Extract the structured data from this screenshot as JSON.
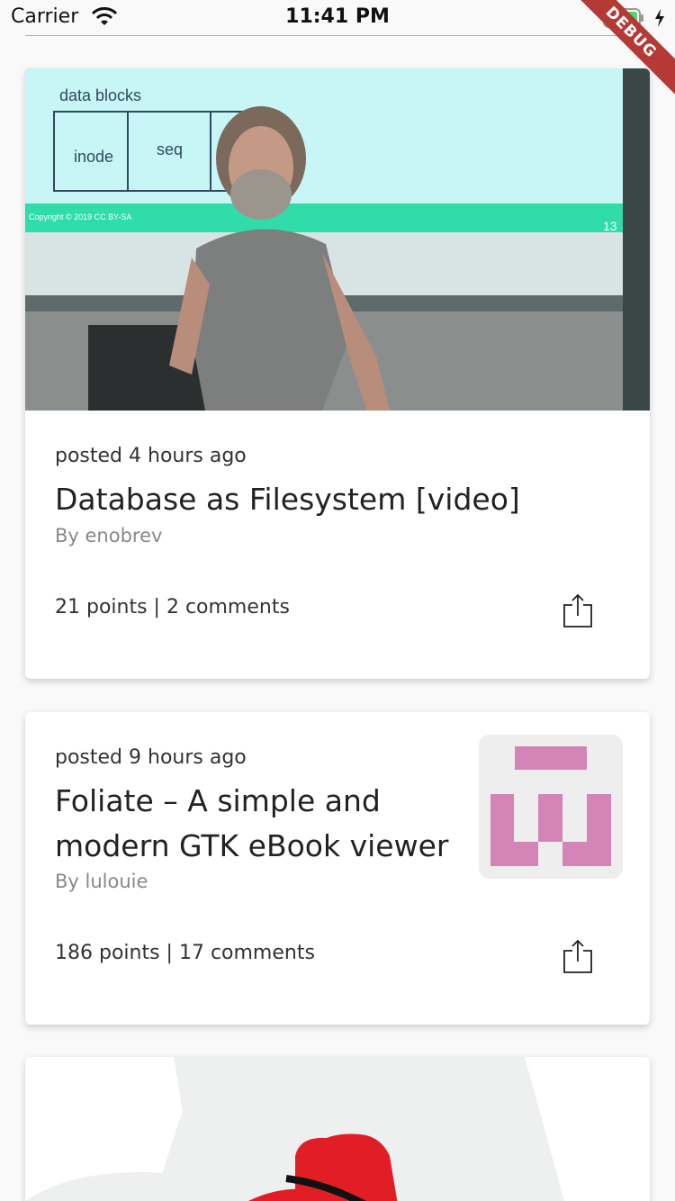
{
  "status": {
    "carrier": "Carrier",
    "time": "11:41 PM",
    "icons": [
      "wifi-icon",
      "battery-icon",
      "charging-icon"
    ]
  },
  "debug_banner": "DEBUG",
  "stories": [
    {
      "posted": "posted 4 hours ago",
      "title": "Database as Filesystem [video]",
      "author": "By enobrev",
      "stats": "21 points | 2 comments",
      "image": "video-still-presenter",
      "slide_text": {
        "heading": "data blocks",
        "cells": [
          "inode",
          "seq"
        ],
        "copyright": "Copyright © 2019 CC BY-SA",
        "page": "13"
      }
    },
    {
      "posted": "posted 9 hours ago",
      "title_lines": [
        "Foliate – A simple and",
        "modern GTK eBook viewer"
      ],
      "author": "By lulouie",
      "stats": "186 points | 17 comments",
      "thumbnail": "foliate-logo"
    },
    {
      "image": "red-hat-logo"
    }
  ],
  "colors": {
    "accent_pink": "#d584b8",
    "debug_red": "#b53a36",
    "battery_green": "#4cd964",
    "redhat_red": "#e11d25",
    "slide_cyan": "#c8f6f6",
    "slide_green": "#2fdcaa"
  }
}
